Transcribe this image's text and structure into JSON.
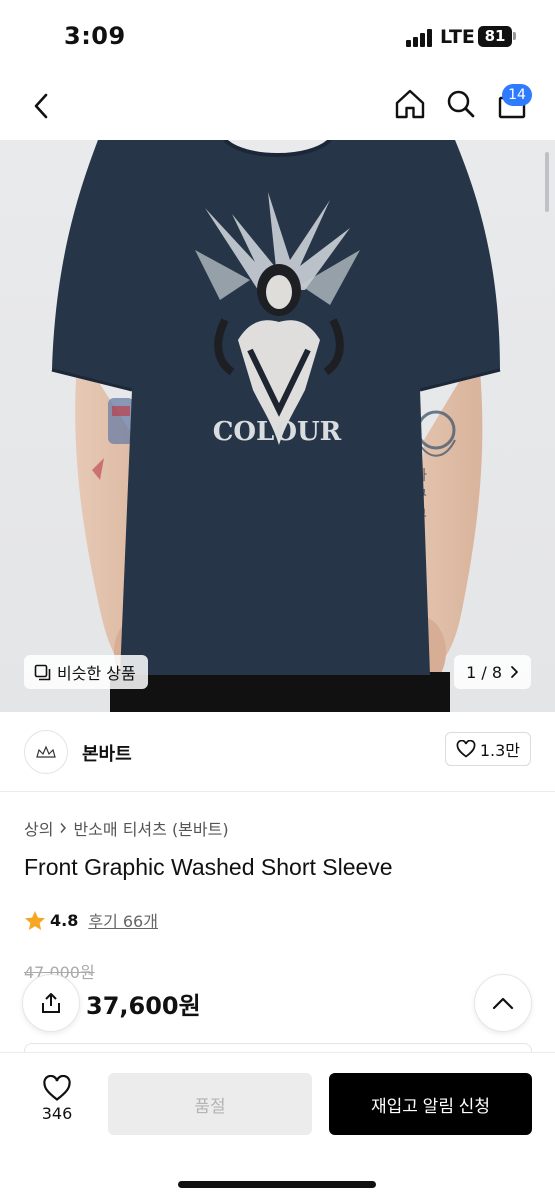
{
  "status_bar": {
    "time": "3:09",
    "network": "LTE",
    "battery": "81"
  },
  "nav": {
    "cart_badge": "14"
  },
  "hero": {
    "print_text": "COLOUR",
    "similar_label": "비슷한 상품",
    "page_indicator": "1 / 8"
  },
  "brand": {
    "name": "본바트",
    "likes": "1.3만"
  },
  "product": {
    "breadcrumb_category": "상의",
    "breadcrumb_sub": "반소매 티셔츠 (본바트)",
    "title": "Front Graphic Washed Short Sleeve",
    "rating": "4.8",
    "reviews": "후기 66개",
    "original_price": "47,000원",
    "sale_price": "37,600원"
  },
  "bottom_bar": {
    "wishlist_count": "346",
    "soldout_label": "품절",
    "restock_label": "재입고 알림 신청"
  },
  "colors": {
    "accent_blue": "#2f7bff",
    "star": "#f5a623",
    "shirt": "#263548"
  }
}
